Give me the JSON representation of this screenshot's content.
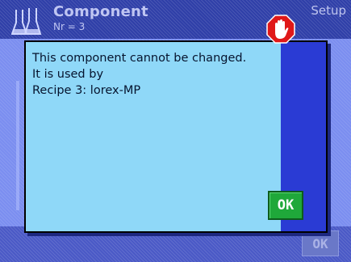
{
  "header": {
    "title": "Component",
    "subtitle": "Nr = 3",
    "setup_label": "Setup"
  },
  "background": {
    "ok_label": "OK"
  },
  "dialog": {
    "lines": [
      "This component cannot be changed.",
      "It is used by",
      "Recipe 3: lorex-MP"
    ],
    "ok_label": "OK",
    "icon": "stop-hand-icon"
  },
  "colors": {
    "message_background": "#8fd8f8",
    "side_panel": "#2a3bd4",
    "ok_button": "#1fa83a",
    "stop_icon": "#e01818"
  }
}
